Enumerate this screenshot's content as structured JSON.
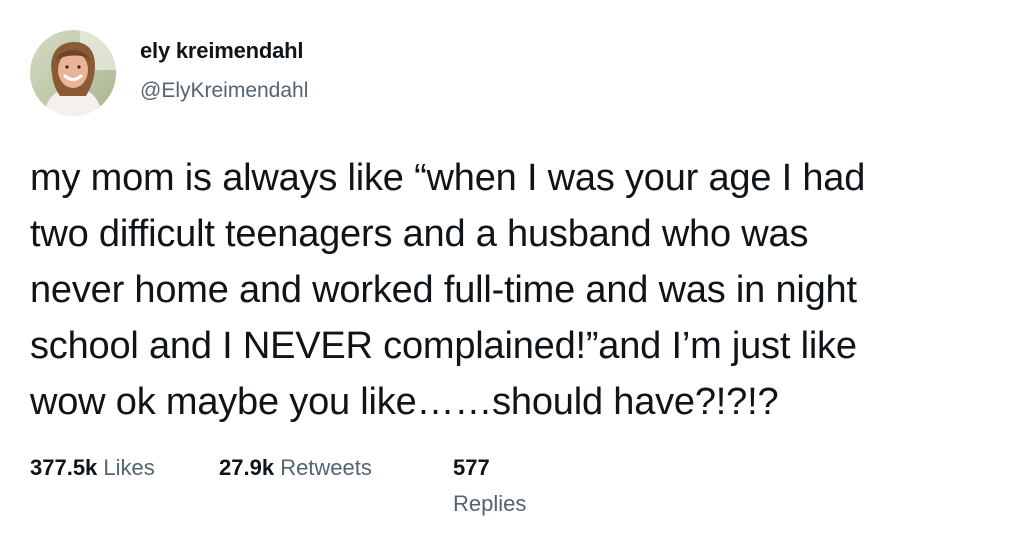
{
  "author": {
    "display_name": "ely kreimendahl",
    "handle": "@ElyKreimendahl",
    "avatar_icon": "profile-photo"
  },
  "tweet": {
    "lines": [
      "my mom is always like “when I was your age I had",
      "two difficult teenagers and a husband who was",
      "never home and worked full-time and was in night",
      "school and I NEVER complained!”and I’m just like",
      "wow ok maybe you like……should have?!?!?"
    ]
  },
  "stats": {
    "likes": {
      "count": "377.5k",
      "label": "Likes"
    },
    "retweets": {
      "count": "27.9k",
      "label": "Retweets"
    },
    "replies": {
      "count": "577",
      "label": "Replies"
    }
  },
  "colors": {
    "text_primary": "#0f1419",
    "text_secondary": "#536471",
    "background": "#ffffff"
  }
}
